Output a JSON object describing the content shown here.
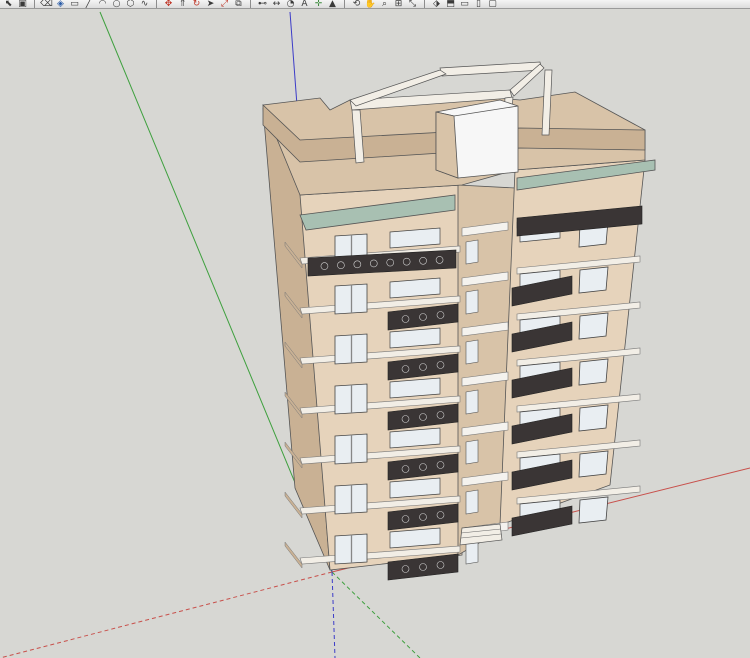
{
  "app": "SketchUp",
  "toolbar": {
    "groups": [
      [
        {
          "name": "select-tool-icon",
          "glyph": "⬉",
          "color": "#3a3a3a"
        },
        {
          "name": "make-component-icon",
          "glyph": "▣",
          "color": "#3a3a3a"
        }
      ],
      [
        {
          "name": "eraser-icon",
          "glyph": "⌫",
          "color": "#3a3a3a"
        },
        {
          "name": "paint-bucket-icon",
          "glyph": "◈",
          "color": "#2c5da8"
        },
        {
          "name": "rectangle-icon",
          "glyph": "▭",
          "color": "#3a3a3a"
        },
        {
          "name": "line-tool-icon",
          "glyph": "╱",
          "color": "#3a3a3a"
        },
        {
          "name": "arc-icon",
          "glyph": "◠",
          "color": "#3a3a3a"
        },
        {
          "name": "circle-icon",
          "glyph": "○",
          "color": "#3a3a3a"
        },
        {
          "name": "polygon-icon",
          "glyph": "⬡",
          "color": "#3a3a3a"
        },
        {
          "name": "freehand-icon",
          "glyph": "∿",
          "color": "#3a3a3a"
        }
      ],
      [
        {
          "name": "move-icon",
          "glyph": "✥",
          "color": "#c0392b"
        },
        {
          "name": "push-pull-icon",
          "glyph": "⇑",
          "color": "#3a3a3a"
        },
        {
          "name": "rotate-icon",
          "glyph": "↻",
          "color": "#c0392b"
        },
        {
          "name": "follow-me-icon",
          "glyph": "➤",
          "color": "#3a3a3a"
        },
        {
          "name": "scale-icon",
          "glyph": "⤢",
          "color": "#c0392b"
        },
        {
          "name": "offset-icon",
          "glyph": "⧉",
          "color": "#3a3a3a"
        }
      ],
      [
        {
          "name": "tape-measure-icon",
          "glyph": "⊷",
          "color": "#3a3a3a"
        },
        {
          "name": "dimension-icon",
          "glyph": "↔",
          "color": "#3a3a3a"
        },
        {
          "name": "protractor-icon",
          "glyph": "◔",
          "color": "#3a3a3a"
        },
        {
          "name": "text-tool-icon",
          "glyph": "A",
          "color": "#3a3a3a"
        },
        {
          "name": "axes-icon",
          "glyph": "✛",
          "color": "#3d8a3d"
        },
        {
          "name": "3d-text-icon",
          "glyph": "▲",
          "color": "#3a3a3a"
        }
      ],
      [
        {
          "name": "orbit-icon",
          "glyph": "⟲",
          "color": "#3a3a3a"
        },
        {
          "name": "pan-icon",
          "glyph": "✋",
          "color": "#3a3a3a"
        },
        {
          "name": "zoom-icon",
          "glyph": "⌕",
          "color": "#3a3a3a"
        },
        {
          "name": "zoom-window-icon",
          "glyph": "⊞",
          "color": "#3a3a3a"
        },
        {
          "name": "zoom-extents-icon",
          "glyph": "⤡",
          "color": "#3a3a3a"
        }
      ],
      [
        {
          "name": "iso-view-icon",
          "glyph": "⬗",
          "color": "#3a3a3a"
        },
        {
          "name": "top-view-icon",
          "glyph": "⬒",
          "color": "#3a3a3a"
        },
        {
          "name": "front-view-icon",
          "glyph": "▭",
          "color": "#3a3a3a"
        },
        {
          "name": "right-view-icon",
          "glyph": "▯",
          "color": "#3a3a3a"
        },
        {
          "name": "back-view-icon",
          "glyph": "▢",
          "color": "#3a3a3a"
        }
      ]
    ]
  },
  "viewport": {
    "background": "#d7d7d3",
    "axis_colors": {
      "red": "#c8504b",
      "green": "#3ea03e",
      "blue": "#3c3cc8"
    },
    "materials": {
      "wall_front": "#e6d3bb",
      "wall_side": "#d8c3a8",
      "wall_dark": "#c9b194",
      "trim": "#f2eee6",
      "glass": "#e9eef2",
      "canopy": "#a8c0b2",
      "railing": "#3a3535",
      "stair_slab": "#f4f2ee",
      "white_box": "#f7f7f7"
    }
  }
}
